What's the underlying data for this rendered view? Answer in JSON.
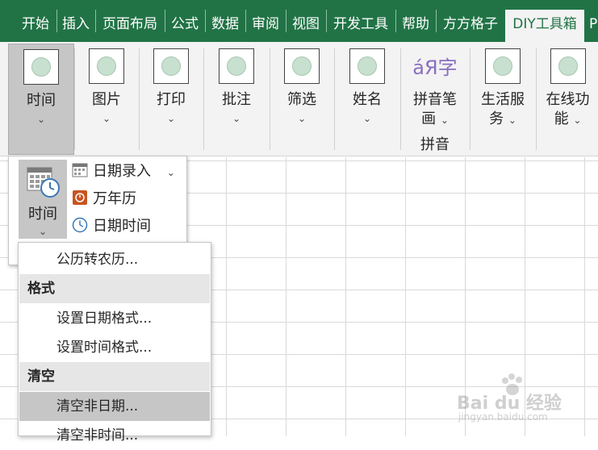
{
  "tabs": [
    {
      "label": "开始"
    },
    {
      "label": "插入"
    },
    {
      "label": "页面布局"
    },
    {
      "label": "公式"
    },
    {
      "label": "数据"
    },
    {
      "label": "审阅"
    },
    {
      "label": "视图"
    },
    {
      "label": "开发工具"
    },
    {
      "label": "帮助"
    },
    {
      "label": "方方格子"
    },
    {
      "label": "DIY工具箱"
    },
    {
      "label": "P"
    }
  ],
  "ribbon": {
    "time": {
      "label": "时间",
      "caret": "⌄"
    },
    "picture": {
      "label": "图片",
      "caret": "⌄"
    },
    "print": {
      "label": "打印",
      "caret": "⌄"
    },
    "comment": {
      "label": "批注",
      "caret": "⌄"
    },
    "filter": {
      "label": "筛选",
      "caret": "⌄"
    },
    "name": {
      "label": "姓名",
      "caret": "⌄"
    },
    "pinyin": {
      "label_line1": "拼音笔",
      "label_line2": "画",
      "caret": "⌄",
      "icon_letters": "áЯ字",
      "group": "拼音"
    },
    "life": {
      "label_line1": "生活服",
      "label_line2": "务",
      "caret": "⌄"
    },
    "online": {
      "label_line1": "在线功",
      "label_line2": "能",
      "caret": "⌄"
    }
  },
  "time_panel": {
    "big_label": "时间",
    "caret": "⌄",
    "items": [
      {
        "label": "日期录入",
        "caret": "⌄"
      },
      {
        "label": "万年历"
      },
      {
        "label": "日期时间"
      }
    ]
  },
  "menu": {
    "items": [
      {
        "label": "公历转农历..."
      },
      {
        "label": "格式"
      },
      {
        "label": "设置日期格式..."
      },
      {
        "label": "设置时间格式..."
      },
      {
        "label": "清空"
      },
      {
        "label": "清空非日期..."
      },
      {
        "label": "清空非时间..."
      }
    ]
  },
  "watermark": {
    "brand": "Bai du 经验",
    "url": "jingyan.baidu.com"
  }
}
